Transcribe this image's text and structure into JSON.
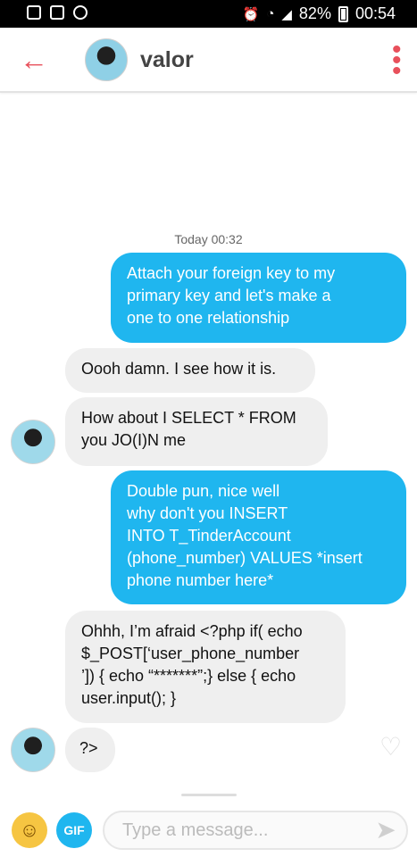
{
  "statusbar": {
    "battery": "82%",
    "time": "00:54",
    "icons": [
      "image-icon",
      "retweet-icon",
      "account-icon",
      "alarm-icon",
      "wifi-icon",
      "signal-icon",
      "battery-icon"
    ]
  },
  "header": {
    "back_icon": "arrow-left-icon",
    "name": "valor",
    "menu_icon": "more-vertical-icon"
  },
  "conversation": {
    "day_label": "Today 00:32",
    "messages": [
      {
        "side": "out",
        "text": "Attach your foreign key to my\nprimary key and let's make a\none to one relationship"
      },
      {
        "side": "in",
        "text": "Oooh damn. I see how it is."
      },
      {
        "side": "in",
        "text": "How about I SELECT * FROM\nyou JO(I)N me"
      },
      {
        "side": "out",
        "text": "Double pun, nice well\nwhy don't you INSERT\nINTO T_TinderAccount\n(phone_number) VALUES *insert\nphone number here*"
      },
      {
        "side": "in",
        "text": "Ohhh, I’m afraid <?php if( echo\n$_POST[‘user_phone_number\n’]) { echo “*******”;} else { echo\nuser.input(); }"
      },
      {
        "side": "in",
        "text": "?>"
      }
    ]
  },
  "composer": {
    "emoji_icon": "smiley-icon",
    "gif_label": "GIF",
    "placeholder": "Type a message...",
    "send_icon": "send-icon",
    "like_icon": "heart-icon"
  },
  "colors": {
    "accent": "#e8505b",
    "outgoing_bubble": "#1fb6ef",
    "incoming_bubble": "#efefef"
  }
}
